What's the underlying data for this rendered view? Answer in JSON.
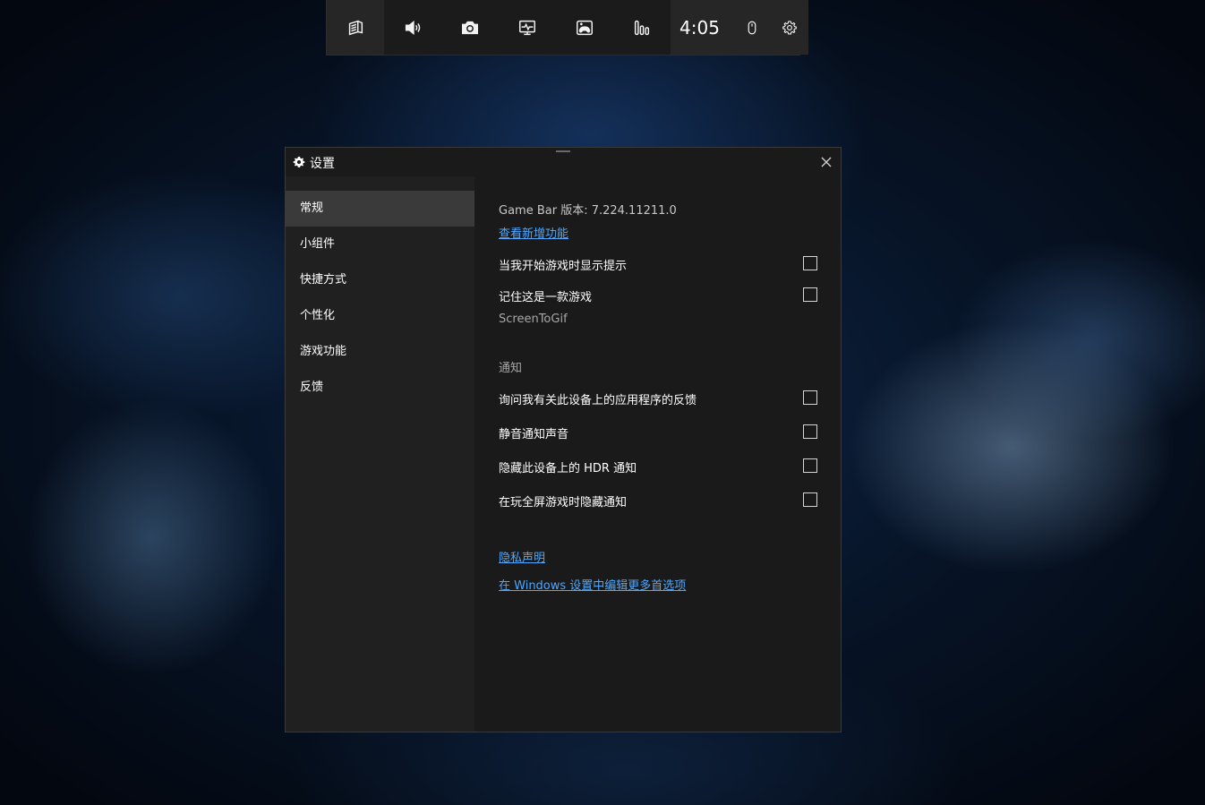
{
  "gamebar": {
    "time": "4:05",
    "buttons": [
      {
        "icon": "widget-menu-icon"
      },
      {
        "icon": "audio-icon"
      },
      {
        "icon": "capture-icon"
      },
      {
        "icon": "performance-icon"
      },
      {
        "icon": "xbox-social-icon"
      },
      {
        "icon": "resources-icon"
      }
    ]
  },
  "window": {
    "title": "设置",
    "sidebar": [
      "常规",
      "小组件",
      "快捷方式",
      "个性化",
      "游戏功能",
      "反馈"
    ],
    "active_index": 0,
    "content": {
      "version": "Game Bar 版本: 7.224.11211.0",
      "whats_new_link": "查看新增功能",
      "show_tips": "当我开始游戏时显示提示",
      "remember_game": "记住这是一款游戏",
      "app_name": "ScreenToGif",
      "notifications_header": "通知",
      "ask_feedback": "询问我有关此设备上的应用程序的反馈",
      "mute_sounds": "静音通知声音",
      "hide_hdr": "隐藏此设备上的 HDR 通知",
      "hide_fullscreen": "在玩全屏游戏时隐藏通知",
      "privacy_link": "隐私声明",
      "windows_settings_link": "在 Windows 设置中编辑更多首选项"
    },
    "checkboxes": {
      "show_tips": false,
      "remember_game": false,
      "ask_feedback": false,
      "mute_sounds": false,
      "hide_hdr": false,
      "hide_fullscreen": false
    }
  },
  "colors": {
    "link": "#4ca8ff",
    "window_bg": "#202020",
    "content_bg": "#1a1a1a",
    "active_item": "#3a3a3a"
  }
}
